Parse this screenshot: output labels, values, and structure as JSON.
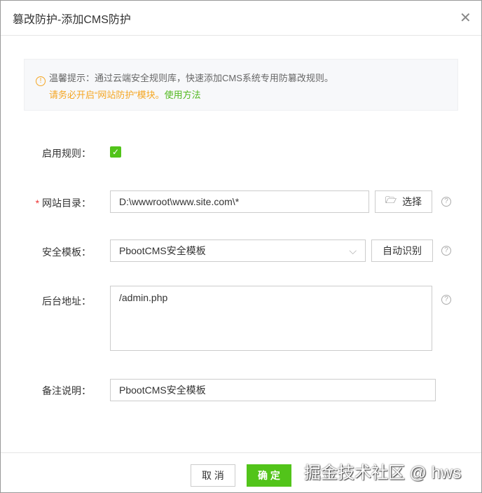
{
  "dialog": {
    "title": "篡改防护-添加CMS防护",
    "close_icon": "close-icon"
  },
  "notice": {
    "line1": "温馨提示：通过云端安全规则库，快速添加CMS系统专用防篡改规则。",
    "line2": "请务必开启“网站防护”模块。",
    "link": "使用方法",
    "icon": "!"
  },
  "form": {
    "enable_label": "启用规则：",
    "enable_checked": true,
    "check_glyph": "✓",
    "dir_required": "*",
    "dir_label": "网站目录：",
    "dir_value": "D:\\wwwroot\\www.site.com\\*",
    "dir_button": "选择",
    "template_label": "安全模板：",
    "template_value": "PbootCMS安全模板",
    "template_button": "自动识别",
    "admin_label": "后台地址：",
    "admin_value": "/admin.php",
    "note_label": "备注说明：",
    "note_value": "PbootCMS安全模板",
    "help": "?"
  },
  "footer": {
    "cancel": "取 消",
    "ok": "确 定"
  },
  "watermark": "掘金技术社区 @ hws"
}
